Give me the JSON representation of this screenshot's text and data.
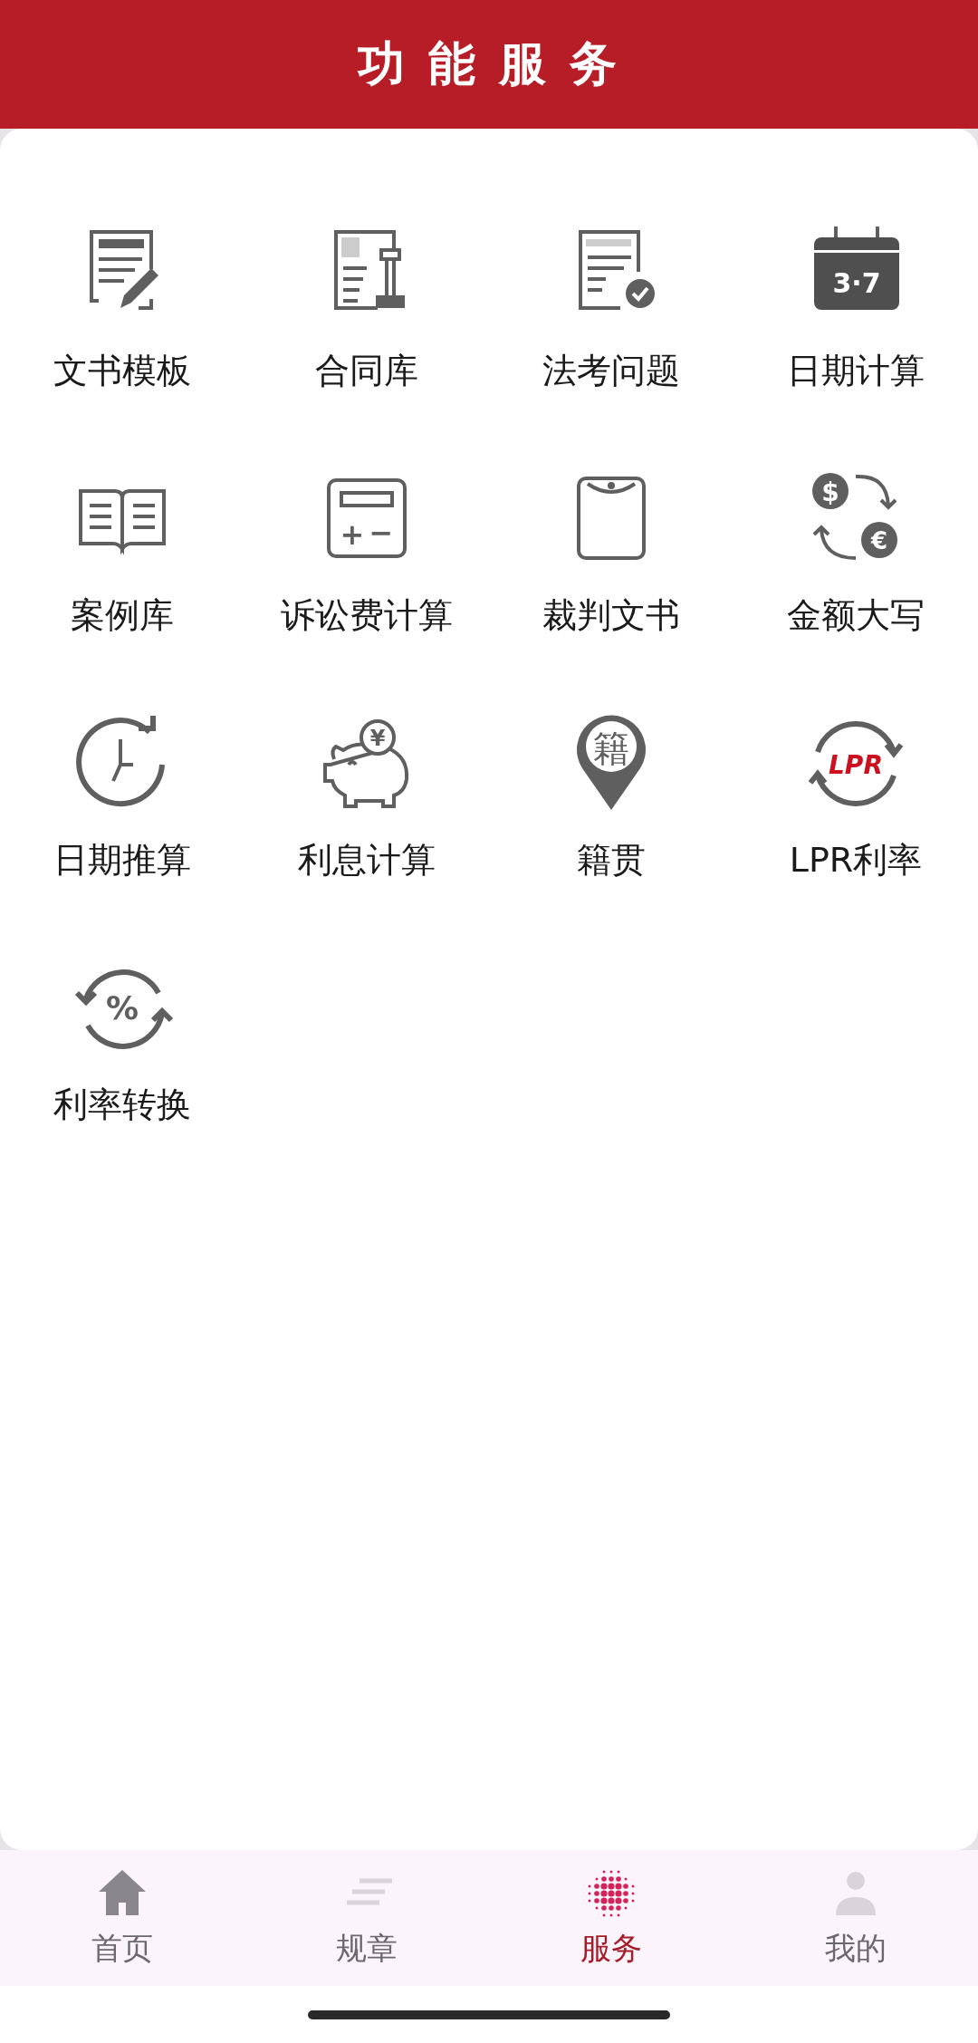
{
  "header": {
    "title": "功 能 服 务"
  },
  "services": [
    {
      "label": "文书模板",
      "kind": "doc-edit"
    },
    {
      "label": "合同库",
      "kind": "doc-stamp"
    },
    {
      "label": "法考问题",
      "kind": "doc-check"
    },
    {
      "label": "日期计算",
      "kind": "calendar",
      "glyphs": [
        "3·7"
      ]
    },
    {
      "label": "案例库",
      "kind": "book"
    },
    {
      "label": "诉讼费计算",
      "kind": "calculator",
      "glyphs": [
        "+",
        "−"
      ]
    },
    {
      "label": "裁判文书",
      "kind": "tablet"
    },
    {
      "label": "金额大写",
      "kind": "exchange",
      "glyphs": [
        "$",
        "€"
      ]
    },
    {
      "label": "日期推算",
      "kind": "clock"
    },
    {
      "label": "利息计算",
      "kind": "piggy",
      "glyphs": [
        "¥"
      ]
    },
    {
      "label": "籍贯",
      "kind": "pin",
      "glyphs": [
        "籍"
      ]
    },
    {
      "label": "LPR利率",
      "kind": "cycle-red",
      "glyphs": [
        "LPR"
      ]
    },
    {
      "label": "利率转换",
      "kind": "cycle-arrows",
      "glyphs": [
        "%"
      ]
    }
  ],
  "nav": [
    {
      "label": "首页",
      "kind": "home",
      "selected": false
    },
    {
      "label": "规章",
      "kind": "lines",
      "selected": false
    },
    {
      "label": "服务",
      "kind": "dots",
      "selected": true
    },
    {
      "label": "我的",
      "kind": "person",
      "selected": false
    }
  ]
}
